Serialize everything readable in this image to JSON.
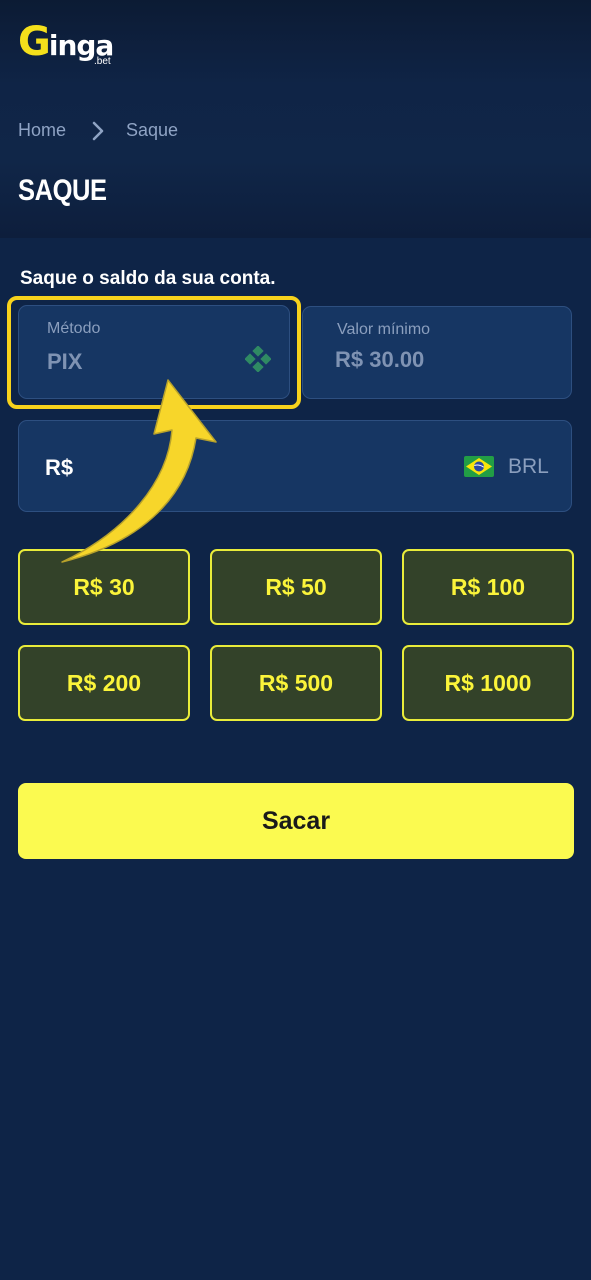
{
  "brand": {
    "logo_g": "G",
    "logo_text": "inga",
    "logo_sub": ".bet"
  },
  "breadcrumb": {
    "home": "Home",
    "current": "Saque"
  },
  "page": {
    "title": "SAQUE",
    "subtitle": "Saque o saldo da sua conta."
  },
  "method": {
    "label": "Método",
    "value": "PIX",
    "icon": "pix-icon"
  },
  "minimum": {
    "label": "Valor mínimo",
    "value": "R$ 30.00"
  },
  "amount_input": {
    "prefix": "R$",
    "currency": "BRL",
    "flag": "brazil-flag-icon"
  },
  "quick_amounts": [
    "R$ 30",
    "R$ 50",
    "R$ 100",
    "R$ 200",
    "R$ 500",
    "R$ 1000"
  ],
  "submit_label": "Sacar",
  "colors": {
    "background": "#0e2447",
    "accent_yellow": "#fbfa50",
    "highlight": "#f7d21c",
    "amount_button_bg": "#334229",
    "field_bg": "#163663"
  }
}
